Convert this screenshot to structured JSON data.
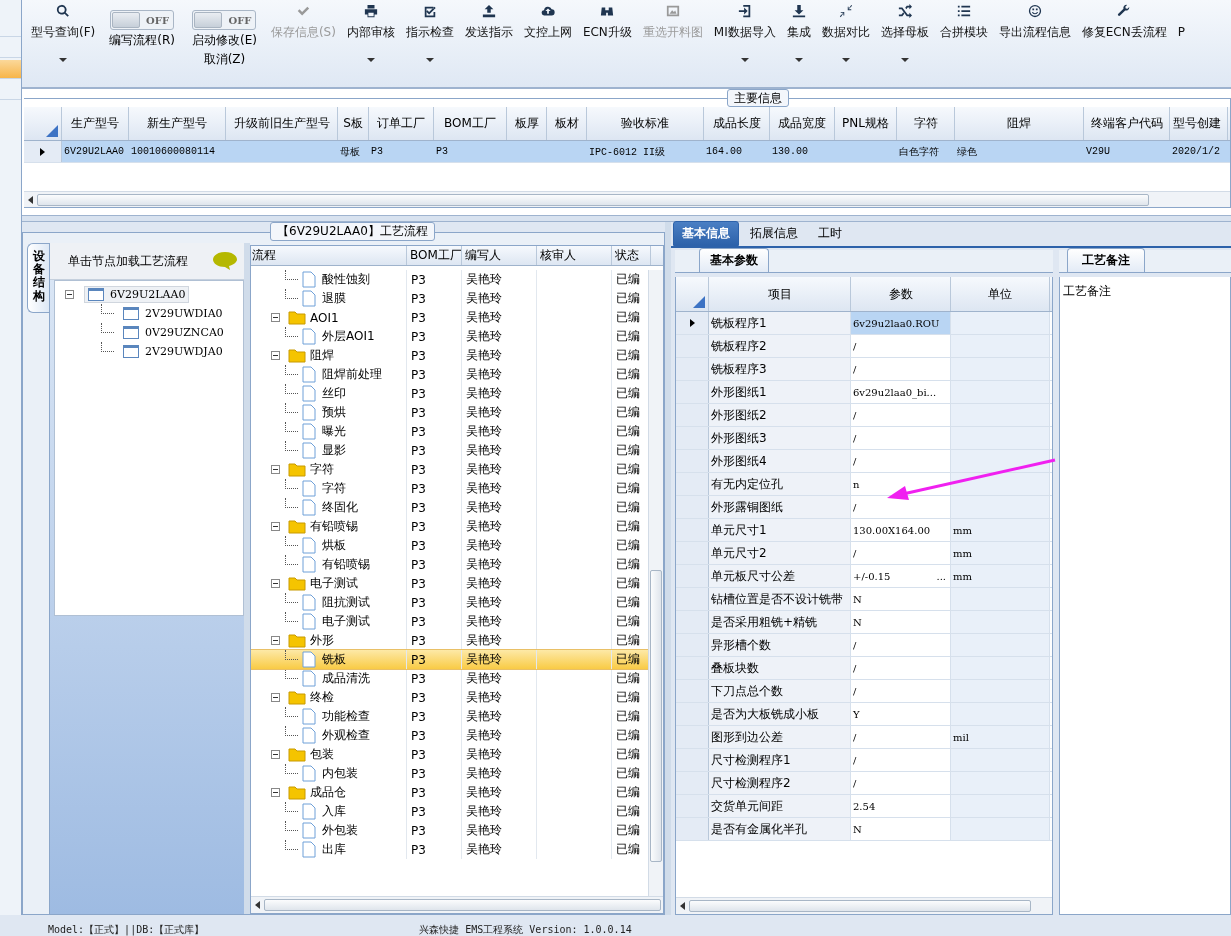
{
  "toolbar": [
    {
      "kind": "button",
      "label": "型号查询(F)",
      "dropdown": true,
      "disabled": false
    },
    {
      "kind": "toggle",
      "switch_text": "OFF",
      "on": false,
      "label": "编写流程(R)"
    },
    {
      "kind": "toggle",
      "switch_text": "OFF",
      "on": false,
      "label": "启动修改(E)",
      "sublabel": "取消(Z)"
    },
    {
      "kind": "button",
      "label": "保存信息(S)",
      "dropdown": false,
      "disabled": true
    },
    {
      "kind": "button",
      "label": "内部审核",
      "dropdown": true,
      "disabled": false
    },
    {
      "kind": "button",
      "label": "指示检查",
      "dropdown": true,
      "disabled": false
    },
    {
      "kind": "button",
      "label": "发送指示",
      "dropdown": false,
      "disabled": false
    },
    {
      "kind": "button",
      "label": "文控上网",
      "dropdown": false,
      "disabled": false
    },
    {
      "kind": "button",
      "label": "ECN升级",
      "dropdown": false,
      "disabled": false
    },
    {
      "kind": "button",
      "label": "重选开料图",
      "dropdown": false,
      "disabled": true
    },
    {
      "kind": "button",
      "label": "MI数据导入",
      "dropdown": true,
      "disabled": false
    },
    {
      "kind": "button",
      "label": "集成",
      "dropdown": true,
      "disabled": false
    },
    {
      "kind": "button",
      "label": "数据对比",
      "dropdown": true,
      "disabled": false
    },
    {
      "kind": "button",
      "label": "选择母板",
      "dropdown": true,
      "disabled": false
    },
    {
      "kind": "button",
      "label": "合拼模块",
      "dropdown": false,
      "disabled": false
    },
    {
      "kind": "button",
      "label": "导出流程信息",
      "dropdown": false,
      "disabled": false
    },
    {
      "kind": "button",
      "label": "修复ECN丢流程",
      "dropdown": false,
      "disabled": false
    },
    {
      "kind": "button",
      "label": "P",
      "dropdown": false,
      "disabled": false
    }
  ],
  "main_info": {
    "title": "主要信息",
    "columns": [
      "生产型号",
      "新生产型号",
      "升级前旧生产型号",
      "S板",
      "订单工厂",
      "BOM工厂",
      "板厚",
      "板材",
      "验收标准",
      "成品长度",
      "成品宽度",
      "PNL规格",
      "字符",
      "阻焊",
      "终端客户代码",
      "型号创建"
    ],
    "rows": [
      {
        "selected": true,
        "cells": [
          "6V29U2LAA0",
          "10010600080114",
          null,
          "母板",
          "P3",
          "P3",
          null,
          null,
          "IPC-6012 II级",
          "164.00",
          "130.00",
          null,
          "白色字符",
          "绿色",
          "V29U",
          "2020/1/2"
        ]
      }
    ]
  },
  "flow_panel": {
    "title": "【6V29U2LAA0】工艺流程",
    "side_tab": "设备结构",
    "hint": "单击节点加载工艺流程",
    "equipment_tree": [
      {
        "label": "6V29U2LAA0",
        "selected": true,
        "expanded": true,
        "children": [
          {
            "label": "2V29UWDIA0",
            "selected": false
          },
          {
            "label": "0V29UZNCA0",
            "selected": false
          },
          {
            "label": "2V29UWDJA0",
            "selected": false
          }
        ]
      }
    ],
    "columns": [
      "流程",
      "BOM工厂",
      "编写人",
      "核审人",
      "状态"
    ],
    "rows": [
      {
        "children": [
          {
            "kind": "file",
            "label": "酸性蚀刻",
            "bom": "P3",
            "writer": "吴艳玲",
            "status": "已编",
            "selected": false
          },
          {
            "kind": "file",
            "label": "退膜",
            "bom": "P3",
            "writer": "吴艳玲",
            "status": "已编",
            "selected": false
          }
        ]
      },
      {
        "kind": "folder",
        "label": "AOI1",
        "bom": "P3",
        "writer": "吴艳玲",
        "status": "已编",
        "selected": false,
        "expanded": true,
        "children": [
          {
            "kind": "file",
            "label": "外层AOI1",
            "bom": "P3",
            "writer": "吴艳玲",
            "status": "已编",
            "selected": false
          }
        ]
      },
      {
        "kind": "folder",
        "label": "阻焊",
        "bom": "P3",
        "writer": "吴艳玲",
        "status": "已编",
        "selected": false,
        "expanded": true,
        "children": [
          {
            "kind": "file",
            "label": "阻焊前处理",
            "bom": "P3",
            "writer": "吴艳玲",
            "status": "已编",
            "selected": false
          },
          {
            "kind": "file",
            "label": "丝印",
            "bom": "P3",
            "writer": "吴艳玲",
            "status": "已编",
            "selected": false
          },
          {
            "kind": "file",
            "label": "预烘",
            "bom": "P3",
            "writer": "吴艳玲",
            "status": "已编",
            "selected": false
          },
          {
            "kind": "file",
            "label": "曝光",
            "bom": "P3",
            "writer": "吴艳玲",
            "status": "已编",
            "selected": false
          },
          {
            "kind": "file",
            "label": "显影",
            "bom": "P3",
            "writer": "吴艳玲",
            "status": "已编",
            "selected": false
          }
        ]
      },
      {
        "kind": "folder",
        "label": "字符",
        "bom": "P3",
        "writer": "吴艳玲",
        "status": "已编",
        "selected": false,
        "expanded": true,
        "children": [
          {
            "kind": "file",
            "label": "字符",
            "bom": "P3",
            "writer": "吴艳玲",
            "status": "已编",
            "selected": false
          },
          {
            "kind": "file",
            "label": "终固化",
            "bom": "P3",
            "writer": "吴艳玲",
            "status": "已编",
            "selected": false
          }
        ]
      },
      {
        "kind": "folder",
        "label": "有铅喷锡",
        "bom": "P3",
        "writer": "吴艳玲",
        "status": "已编",
        "selected": false,
        "expanded": true,
        "children": [
          {
            "kind": "file",
            "label": "烘板",
            "bom": "P3",
            "writer": "吴艳玲",
            "status": "已编",
            "selected": false
          },
          {
            "kind": "file",
            "label": "有铅喷锡",
            "bom": "P3",
            "writer": "吴艳玲",
            "status": "已编",
            "selected": false
          }
        ]
      },
      {
        "kind": "folder",
        "label": "电子测试",
        "bom": "P3",
        "writer": "吴艳玲",
        "status": "已编",
        "selected": false,
        "expanded": true,
        "children": [
          {
            "kind": "file",
            "label": "阻抗测试",
            "bom": "P3",
            "writer": "吴艳玲",
            "status": "已编",
            "selected": false
          },
          {
            "kind": "file",
            "label": "电子测试",
            "bom": "P3",
            "writer": "吴艳玲",
            "status": "已编",
            "selected": false
          }
        ]
      },
      {
        "kind": "folder",
        "label": "外形",
        "bom": "P3",
        "writer": "吴艳玲",
        "status": "已编",
        "selected": false,
        "expanded": true,
        "children": [
          {
            "kind": "file",
            "label": "铣板",
            "bom": "P3",
            "writer": "吴艳玲",
            "status": "已编",
            "selected": true
          },
          {
            "kind": "file",
            "label": "成品清洗",
            "bom": "P3",
            "writer": "吴艳玲",
            "status": "已编",
            "selected": false
          }
        ]
      },
      {
        "kind": "folder",
        "label": "终检",
        "bom": "P3",
        "writer": "吴艳玲",
        "status": "已编",
        "selected": false,
        "expanded": true,
        "children": [
          {
            "kind": "file",
            "label": "功能检查",
            "bom": "P3",
            "writer": "吴艳玲",
            "status": "已编",
            "selected": false
          },
          {
            "kind": "file",
            "label": "外观检查",
            "bom": "P3",
            "writer": "吴艳玲",
            "status": "已编",
            "selected": false
          }
        ]
      },
      {
        "kind": "folder",
        "label": "包装",
        "bom": "P3",
        "writer": "吴艳玲",
        "status": "已编",
        "selected": false,
        "expanded": true,
        "children": [
          {
            "kind": "file",
            "label": "内包装",
            "bom": "P3",
            "writer": "吴艳玲",
            "status": "已编",
            "selected": false
          }
        ]
      },
      {
        "kind": "folder",
        "label": "成品仓",
        "bom": "P3",
        "writer": "吴艳玲",
        "status": "已编",
        "selected": false,
        "expanded": true,
        "children": [
          {
            "kind": "file",
            "label": "入库",
            "bom": "P3",
            "writer": "吴艳玲",
            "status": "已编",
            "selected": false
          },
          {
            "kind": "file",
            "label": "外包装",
            "bom": "P3",
            "writer": "吴艳玲",
            "status": "已编",
            "selected": false
          },
          {
            "kind": "file",
            "label": "出库",
            "bom": "P3",
            "writer": "吴艳玲",
            "status": "已编",
            "selected": false
          }
        ]
      }
    ]
  },
  "detail_tabs": [
    {
      "label": "基本信息",
      "selected": true
    },
    {
      "label": "拓展信息",
      "selected": false
    },
    {
      "label": "工时",
      "selected": false
    }
  ],
  "params": {
    "tab": "基本参数",
    "columns": [
      "项目",
      "参数",
      "单位"
    ],
    "rows": [
      {
        "item": "铣板程序1",
        "value": "6v29u2laa0.ROU",
        "selected": true
      },
      {
        "item": "铣板程序2",
        "value": "/",
        "selected": false
      },
      {
        "item": "铣板程序3",
        "value": "/",
        "selected": false
      },
      {
        "item": "外形图纸1",
        "value": "6v29u2laa0_bi...",
        "selected": false
      },
      {
        "item": "外形图纸2",
        "value": "/",
        "selected": false
      },
      {
        "item": "外形图纸3",
        "value": "/",
        "selected": false
      },
      {
        "item": "外形图纸4",
        "value": "/",
        "selected": false
      },
      {
        "item": "有无内定位孔",
        "value": "n",
        "selected": false
      },
      {
        "item": "外形露铜图纸",
        "value": "/",
        "selected": false
      },
      {
        "item": "单元尺寸1",
        "value": "130.00X164.00",
        "unit": "mm",
        "selected": false
      },
      {
        "item": "单元尺寸2",
        "value": "/",
        "unit": "mm",
        "selected": false
      },
      {
        "item": "单元板尺寸公差",
        "value": "+/-0.15",
        "more": "...",
        "unit": "mm",
        "selected": false
      },
      {
        "item": "钻槽位置是否不设计铣带",
        "value": "N",
        "selected": false
      },
      {
        "item": "是否采用粗铣+精铣",
        "value": "N",
        "selected": false
      },
      {
        "item": "异形槽个数",
        "value": "/",
        "selected": false
      },
      {
        "item": "叠板块数",
        "value": "/",
        "selected": false
      },
      {
        "item": "下刀点总个数",
        "value": "/",
        "selected": false
      },
      {
        "item": "是否为大板铣成小板",
        "value": "Y",
        "selected": false
      },
      {
        "item": "图形到边公差",
        "value": "/",
        "unit": "mil",
        "selected": false
      },
      {
        "item": "尺寸检测程序1",
        "value": "/",
        "selected": false
      },
      {
        "item": "尺寸检测程序2",
        "value": "/",
        "selected": false
      },
      {
        "item": "交货单元间距",
        "value": "2.54",
        "selected": false
      },
      {
        "item": "是否有金属化半孔",
        "value": "N",
        "selected": false
      }
    ]
  },
  "notes": {
    "tab": "工艺备注",
    "label": "工艺备注"
  },
  "status_bar": {
    "left": "Model:【正式】||DB:【正式库】",
    "center": "兴森快捷 EMS工程系统 Version: 1.0.0.14"
  }
}
